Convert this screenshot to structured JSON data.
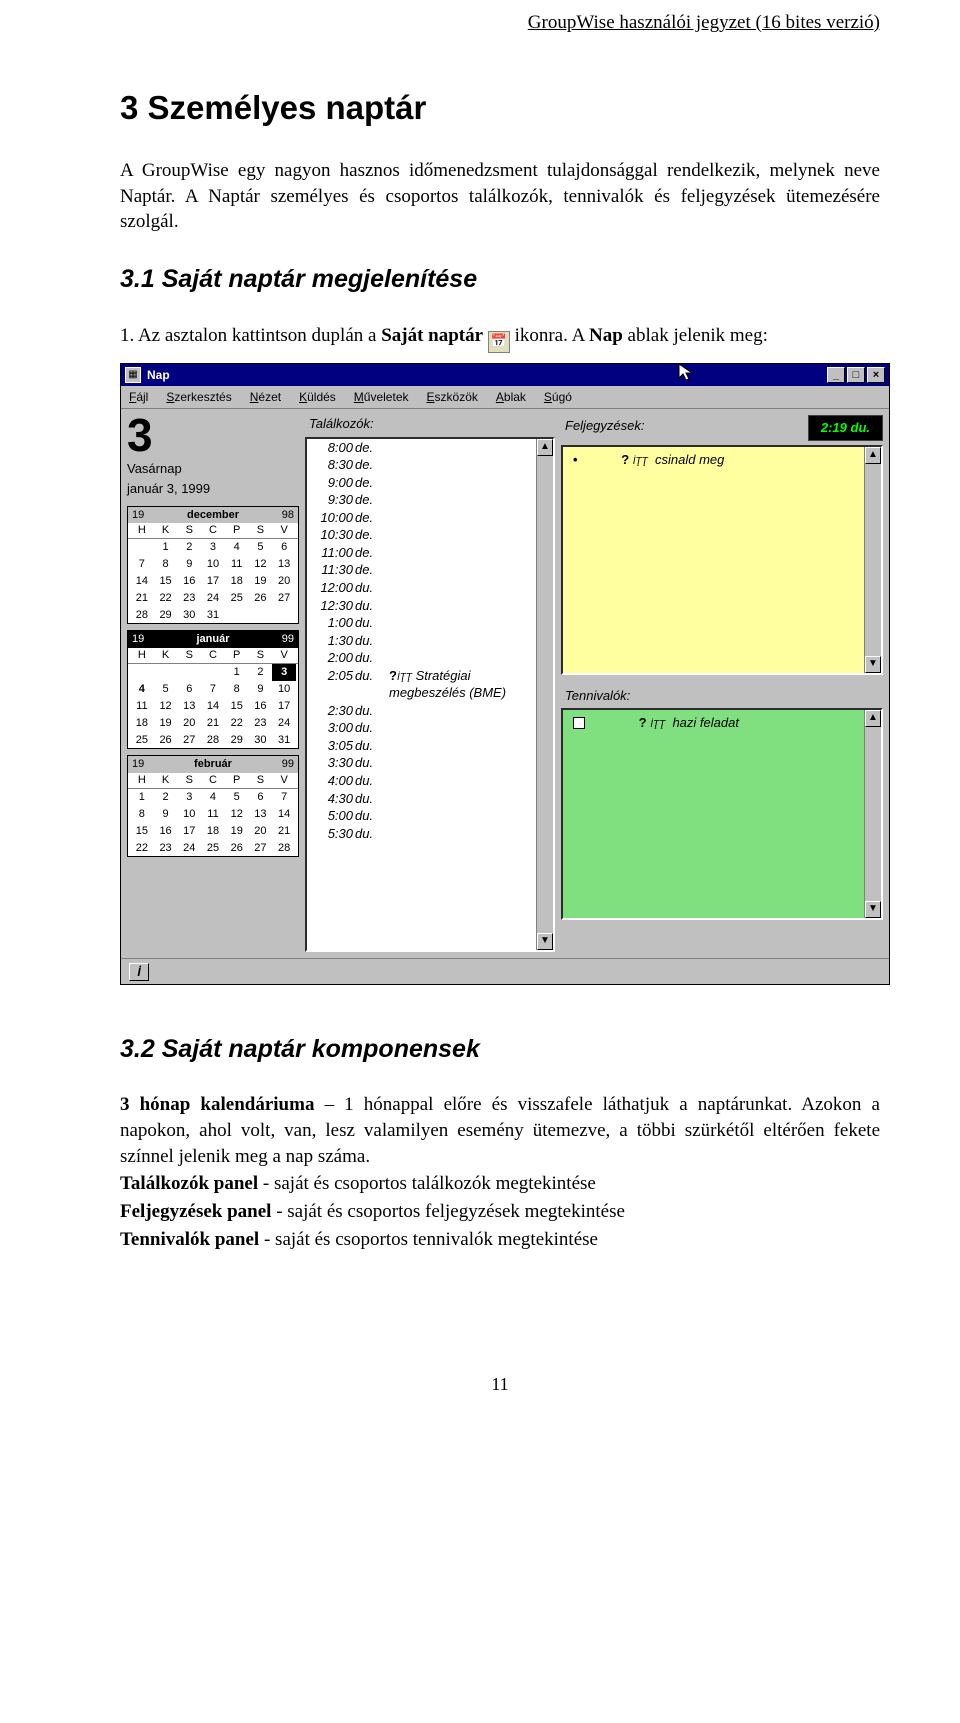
{
  "header": "GroupWise használói jegyzet (16 bites verzió)",
  "chapter_title": "3 Személyes naptár",
  "intro": "A GroupWise egy nagyon hasznos időmenedzsment tulajdonsággal rendelkezik, melynek neve Naptár. A Naptár személyes és csoportos találkozók, tennivalók és feljegyzések ütemezésére szolgál.",
  "section31_title": "3.1 Saját naptár megjelenítése",
  "section31_step_pre": "1. Az asztalon kattintson duplán a ",
  "section31_step_bold": "Saját naptár",
  "section31_step_mid": " ",
  "section31_step_post": " ikonra. A ",
  "section31_step_bold2": "Nap",
  "section31_step_end": " ablak jelenik meg:",
  "section32_title": "3.2 Saját naptár komponensek",
  "defs": {
    "d1a": "3 hónap kalendáriuma",
    "d1b": " – 1 hónappal előre és visszafele láthatjuk a naptárunkat. Azokon a napokon, ahol volt, van, lesz valamilyen esemény ütemezve, a többi szürkétől eltérően fekete színnel jelenik meg a nap száma.",
    "d2a": "Találkozók panel",
    "d2b": " - saját és csoportos találkozók megtekintése",
    "d3a": "Feljegyzések panel",
    "d3b": " - saját és csoportos feljegyzések megtekintése",
    "d4a": "Tennivalók panel",
    "d4b": " - saját és csoportos tennivalók megtekintése"
  },
  "page_number": "11",
  "shot": {
    "title": "Nap",
    "menu": [
      "Fájl",
      "Szerkesztés",
      "Nézet",
      "Küldés",
      "Műveletek",
      "Eszközök",
      "Ablak",
      "Súgó"
    ],
    "day_big": "3",
    "dayname": "Vasárnap",
    "date": "január 3, 1999",
    "dow": [
      "H",
      "K",
      "S",
      "C",
      "P",
      "S",
      "V"
    ],
    "months": [
      {
        "y": "19",
        "name": "december",
        "yr": "98",
        "current": false,
        "weeks": [
          [
            "",
            "1",
            "2",
            "3",
            "4",
            "5",
            "6"
          ],
          [
            "7",
            "8",
            "9",
            "10",
            "11",
            "12",
            "13"
          ],
          [
            "14",
            "15",
            "16",
            "17",
            "18",
            "19",
            "20"
          ],
          [
            "21",
            "22",
            "23",
            "24",
            "25",
            "26",
            "27"
          ],
          [
            "28",
            "29",
            "30",
            "31",
            "",
            "",
            ""
          ]
        ]
      },
      {
        "y": "19",
        "name": "január",
        "yr": "99",
        "current": true,
        "weeks": [
          [
            "",
            "",
            "",
            "",
            "1",
            "2",
            "3"
          ],
          [
            "4",
            "5",
            "6",
            "7",
            "8",
            "9",
            "10"
          ],
          [
            "11",
            "12",
            "13",
            "14",
            "15",
            "16",
            "17"
          ],
          [
            "18",
            "19",
            "20",
            "21",
            "22",
            "23",
            "24"
          ],
          [
            "25",
            "26",
            "27",
            "28",
            "29",
            "30",
            "31"
          ]
        ],
        "selected": "3",
        "bold": [
          "4"
        ]
      },
      {
        "y": "19",
        "name": "február",
        "yr": "99",
        "current": false,
        "weeks": [
          [
            "1",
            "2",
            "3",
            "4",
            "5",
            "6",
            "7"
          ],
          [
            "8",
            "9",
            "10",
            "11",
            "12",
            "13",
            "14"
          ],
          [
            "15",
            "16",
            "17",
            "18",
            "19",
            "20",
            "21"
          ],
          [
            "22",
            "23",
            "24",
            "25",
            "26",
            "27",
            "28"
          ]
        ]
      }
    ],
    "appt_label": "Találkozók:",
    "notes_label": "Feljegyzések:",
    "tasks_label": "Tennivalók:",
    "clock": "2:19 du.",
    "appts": [
      {
        "t": "8:00",
        "u": "de.",
        "bar": false
      },
      {
        "t": "8:30",
        "u": "de.",
        "bar": false
      },
      {
        "t": "9:00",
        "u": "de.",
        "bar": false
      },
      {
        "t": "9:30",
        "u": "de.",
        "bar": false
      },
      {
        "t": "10:00",
        "u": "de.",
        "bar": false
      },
      {
        "t": "10:30",
        "u": "de.",
        "bar": false
      },
      {
        "t": "11:00",
        "u": "de.",
        "bar": false
      },
      {
        "t": "11:30",
        "u": "de.",
        "bar": false
      },
      {
        "t": "12:00",
        "u": "du.",
        "bar": false
      },
      {
        "t": "12:30",
        "u": "du.",
        "bar": false
      },
      {
        "t": "1:00",
        "u": "du.",
        "bar": false
      },
      {
        "t": "1:30",
        "u": "du.",
        "bar": false
      },
      {
        "t": "2:00",
        "u": "du.",
        "bar": true
      },
      {
        "t": "2:05",
        "u": "du.",
        "bar": true,
        "icon": true,
        "txt": "Stratégiai megbeszélés (BME)"
      },
      {
        "t": "2:30",
        "u": "du.",
        "bar": false
      },
      {
        "t": "3:00",
        "u": "du.",
        "bar": false
      },
      {
        "t": "3:05",
        "u": "du.",
        "bar": false
      },
      {
        "t": "3:30",
        "u": "du.",
        "bar": false
      },
      {
        "t": "4:00",
        "u": "du.",
        "bar": false
      },
      {
        "t": "4:30",
        "u": "du.",
        "bar": false
      },
      {
        "t": "5:00",
        "u": "du.",
        "bar": false
      },
      {
        "t": "5:30",
        "u": "du.",
        "bar": false
      }
    ],
    "note_text": "csinald meg",
    "task_text": "hazi feladat",
    "icon_glyph": "?",
    "icon_sub": "İŢŢ"
  }
}
